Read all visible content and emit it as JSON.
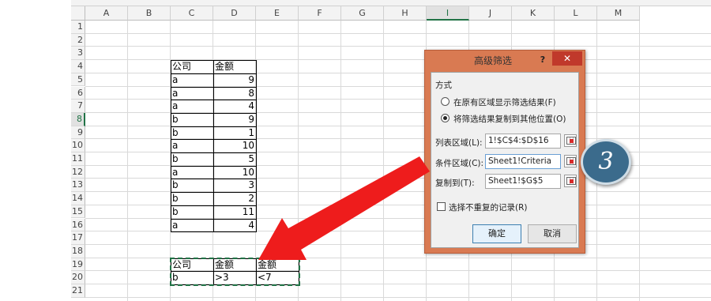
{
  "sheet": {
    "columns": [
      "A",
      "B",
      "C",
      "D",
      "E",
      "F",
      "G",
      "H",
      "I",
      "J",
      "K",
      "L",
      "M"
    ],
    "selected_column": "I",
    "rows": [
      "1",
      "2",
      "3",
      "4",
      "5",
      "6",
      "7",
      "8",
      "9",
      "10",
      "11",
      "12",
      "13",
      "14",
      "15",
      "16",
      "17",
      "18",
      "19",
      "20",
      "21"
    ],
    "selected_row": "8",
    "data_table": {
      "headers": [
        "公司",
        "金额"
      ],
      "rows": [
        [
          "a",
          "9"
        ],
        [
          "a",
          "8"
        ],
        [
          "a",
          "4"
        ],
        [
          "b",
          "9"
        ],
        [
          "b",
          "1"
        ],
        [
          "a",
          "10"
        ],
        [
          "b",
          "5"
        ],
        [
          "a",
          "10"
        ],
        [
          "b",
          "3"
        ],
        [
          "b",
          "2"
        ],
        [
          "b",
          "11"
        ],
        [
          "a",
          "4"
        ]
      ]
    },
    "criteria_table": {
      "headers": [
        "公司",
        "金额",
        "金额"
      ],
      "values": [
        "b",
        ">3",
        "<7"
      ]
    }
  },
  "dialog": {
    "title": "高级筛选",
    "help": "?",
    "close": "✕",
    "mode_label": "方式",
    "option_in_place": "在原有区域显示筛选结果(F)",
    "option_copy": "将筛选结果复制到其他位置(O)",
    "list_range_label": "列表区域(L):",
    "list_range_value": "1!$C$4:$D$16",
    "criteria_range_label": "条件区域(C):",
    "criteria_range_value": "Sheet1!Criteria",
    "copy_to_label": "复制到(T):",
    "copy_to_value": "Sheet1!$G$5",
    "unique_label": "选择不重复的记录(R)",
    "ok_label": "确定",
    "cancel_label": "取消"
  },
  "annotation": {
    "step_number": "3",
    "arrow_color": "#ee1c1c",
    "badge_color": "#3b6b8c"
  }
}
